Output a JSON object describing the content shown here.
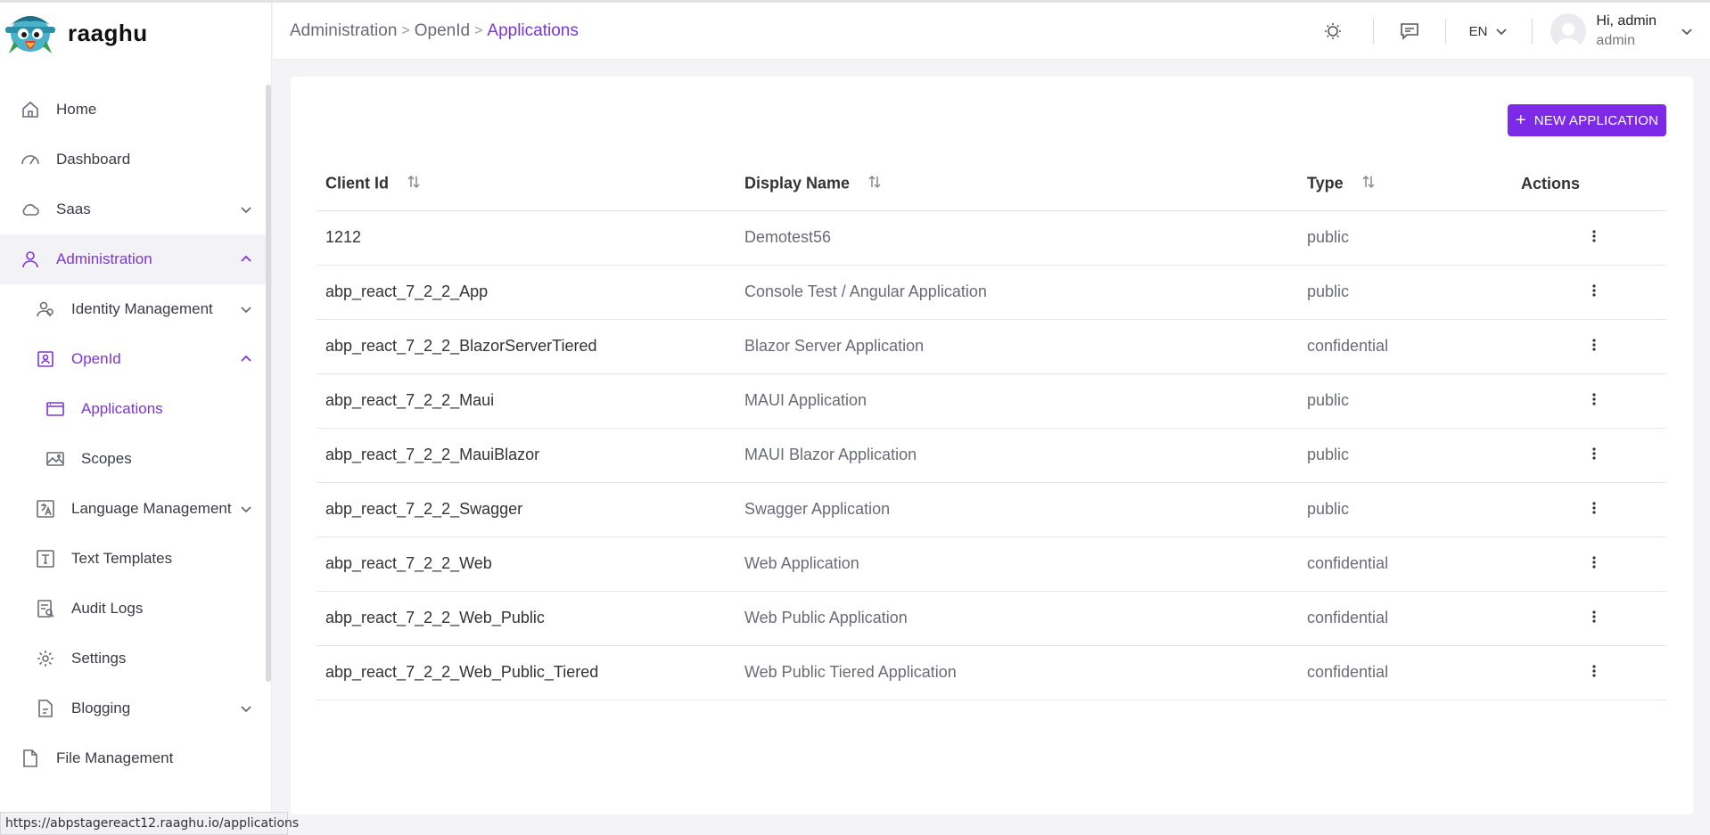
{
  "brand": {
    "name": "raaghu"
  },
  "sidebar": {
    "items": [
      {
        "label": "Home",
        "icon": "home-icon"
      },
      {
        "label": "Dashboard",
        "icon": "dashboard-icon"
      },
      {
        "label": "Saas",
        "icon": "cloud-icon"
      },
      {
        "label": "Administration",
        "icon": "user-icon"
      },
      {
        "label": "Identity Management",
        "icon": "users-icon"
      },
      {
        "label": "OpenId",
        "icon": "id-badge-icon"
      },
      {
        "label": "Applications",
        "icon": "window-icon"
      },
      {
        "label": "Scopes",
        "icon": "image-icon"
      },
      {
        "label": "Language Management",
        "icon": "translate-icon"
      },
      {
        "label": "Text Templates",
        "icon": "text-template-icon"
      },
      {
        "label": "Audit Logs",
        "icon": "audit-log-icon"
      },
      {
        "label": "Settings",
        "icon": "gear-icon"
      },
      {
        "label": "Blogging",
        "icon": "document-icon"
      },
      {
        "label": "File Management",
        "icon": "file-icon"
      }
    ]
  },
  "status_url": "https://abpstagereact12.raaghu.io/applications",
  "header": {
    "breadcrumb": [
      "Administration",
      "OpenId",
      "Applications"
    ],
    "separator": ">",
    "language": "EN",
    "greeting": "Hi, admin",
    "role": "admin"
  },
  "page": {
    "new_button_label": "NEW APPLICATION",
    "new_button_icon": "+",
    "columns": [
      "Client Id",
      "Display Name",
      "Type",
      "Actions"
    ],
    "rows": [
      {
        "client_id": "1212",
        "display_name": "Demotest56",
        "type": "public"
      },
      {
        "client_id": "abp_react_7_2_2_App",
        "display_name": "Console Test / Angular Application",
        "type": "public"
      },
      {
        "client_id": "abp_react_7_2_2_BlazorServerTiered",
        "display_name": "Blazor Server Application",
        "type": "confidential"
      },
      {
        "client_id": "abp_react_7_2_2_Maui",
        "display_name": "MAUI Application",
        "type": "public"
      },
      {
        "client_id": "abp_react_7_2_2_MauiBlazor",
        "display_name": "MAUI Blazor Application",
        "type": "public"
      },
      {
        "client_id": "abp_react_7_2_2_Swagger",
        "display_name": "Swagger Application",
        "type": "public"
      },
      {
        "client_id": "abp_react_7_2_2_Web",
        "display_name": "Web Application",
        "type": "confidential"
      },
      {
        "client_id": "abp_react_7_2_2_Web_Public",
        "display_name": "Web Public Application",
        "type": "confidential"
      },
      {
        "client_id": "abp_react_7_2_2_Web_Public_Tiered",
        "display_name": "Web Public Tiered Application",
        "type": "confidential"
      }
    ]
  },
  "colors": {
    "accent": "#7d2ae8",
    "active_text": "#7d35d9",
    "active_bg": "#f3f2f7"
  }
}
